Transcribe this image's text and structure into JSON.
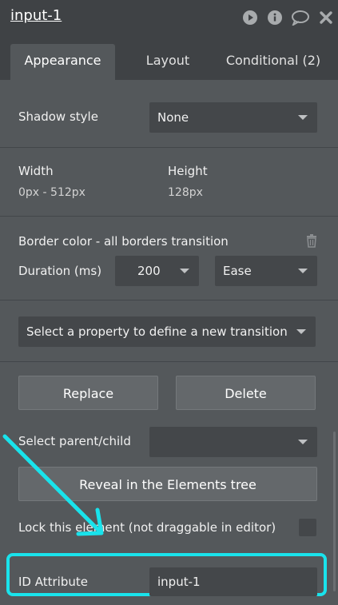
{
  "header": {
    "title": "input-1",
    "icons": [
      "play-icon",
      "info-icon",
      "comment-icon",
      "close-icon"
    ]
  },
  "tabs": [
    {
      "label": "Appearance",
      "active": true
    },
    {
      "label": "Layout",
      "active": false
    },
    {
      "label": "Conditional (2)",
      "active": false
    }
  ],
  "shadow": {
    "label": "Shadow style",
    "value": "None"
  },
  "size": {
    "width_label": "Width",
    "width_value": "0px - 512px",
    "height_label": "Height",
    "height_value": "128px"
  },
  "transition": {
    "title": "Border color - all borders transition",
    "duration_label": "Duration (ms)",
    "duration_value": "200",
    "easing_value": "Ease"
  },
  "new_transition": {
    "placeholder": "Select a property to define a new transition"
  },
  "actions": {
    "replace_label": "Replace",
    "delete_label": "Delete"
  },
  "parent_child": {
    "label": "Select parent/child",
    "value": ""
  },
  "reveal": {
    "label": "Reveal in the Elements tree"
  },
  "lock": {
    "label": "Lock this element (not draggable in editor)",
    "checked": false
  },
  "id_attribute": {
    "label": "ID Attribute",
    "value": "input-1"
  },
  "colors": {
    "highlight": "#19e3ec",
    "panel_bg": "#54585b",
    "header_bg": "#3f4245"
  }
}
